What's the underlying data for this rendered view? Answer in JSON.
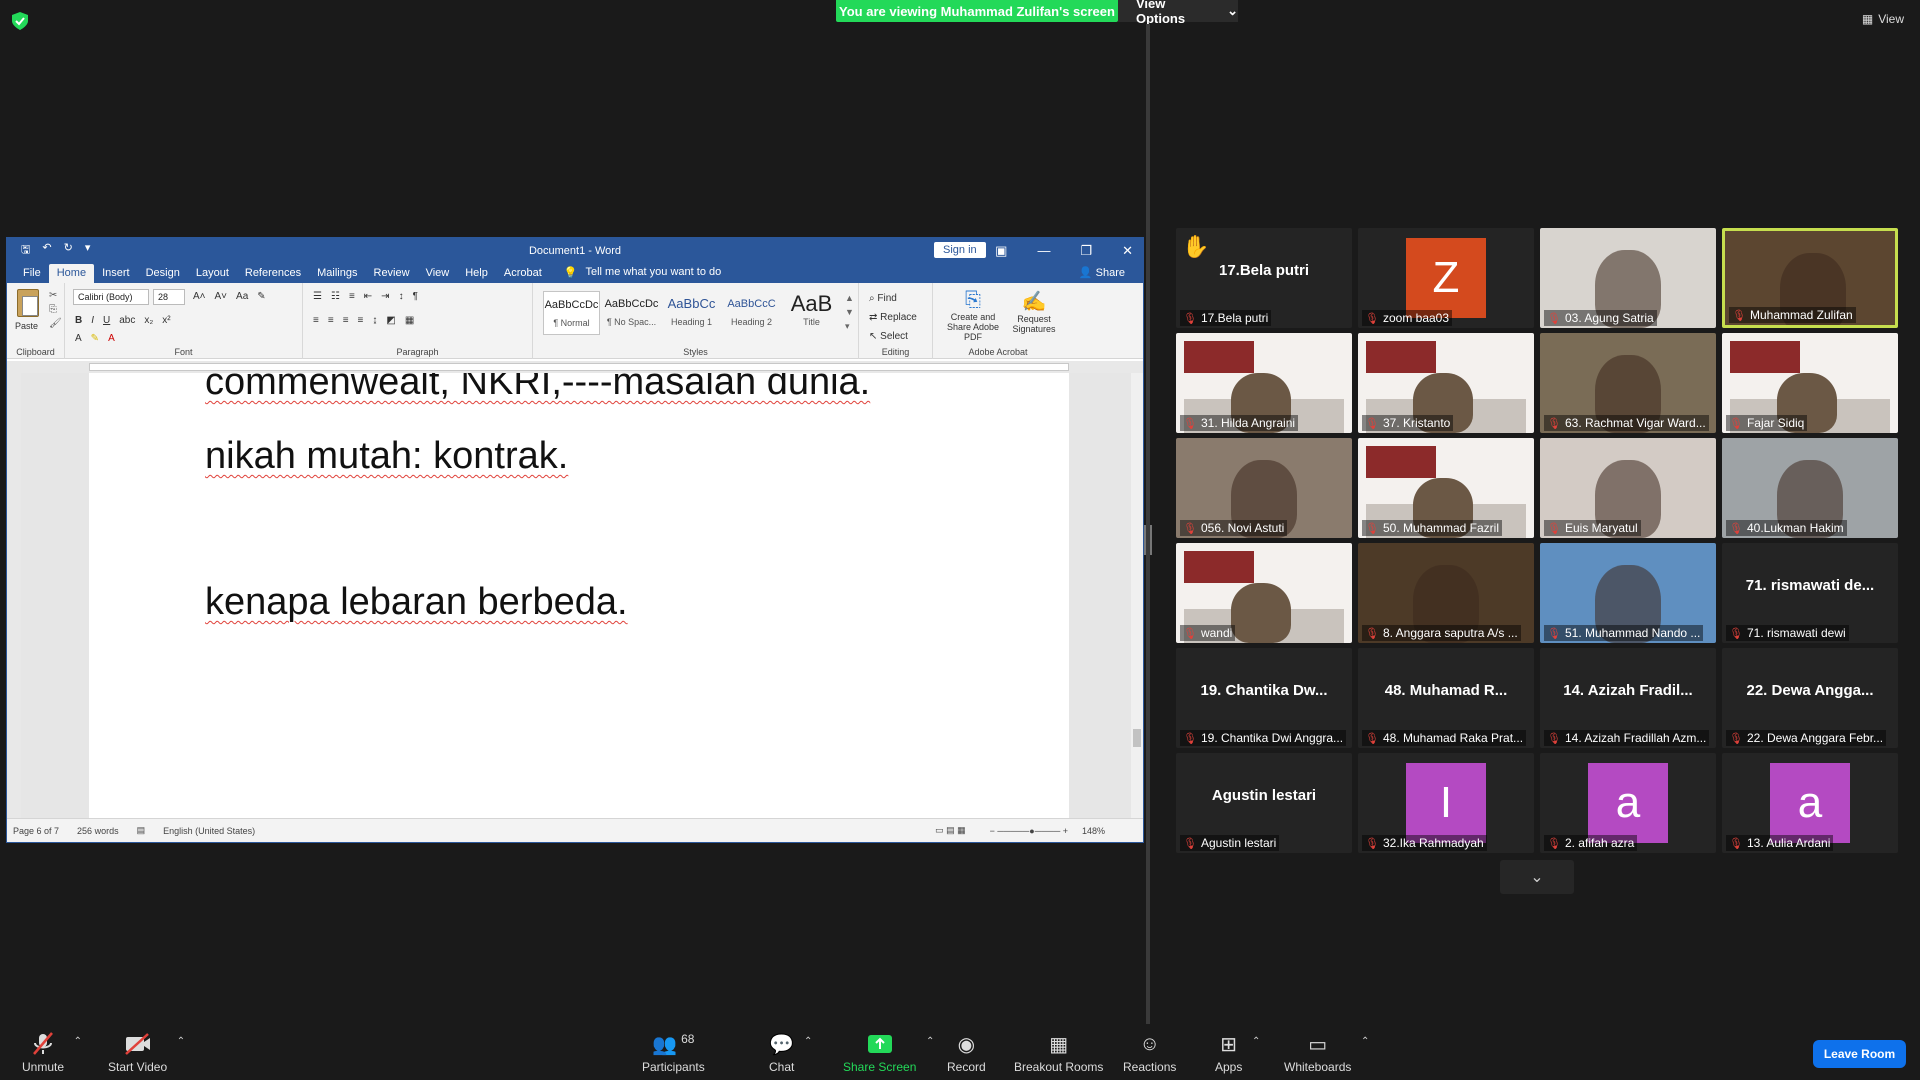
{
  "banner": {
    "text": "You are viewing Muhammad Zulifan's screen",
    "view_options": "View Options",
    "view": "View"
  },
  "word": {
    "title": "Document1 - Word",
    "sign_in": "Sign in",
    "tabs": [
      "File",
      "Home",
      "Insert",
      "Design",
      "Layout",
      "References",
      "Mailings",
      "Review",
      "View",
      "Help",
      "Acrobat"
    ],
    "tell_me": "Tell me what you want to do",
    "share": "Share",
    "font": {
      "name": "Calibri (Body)",
      "size": "28"
    },
    "groups": {
      "clipboard": "Clipboard",
      "font": "Font",
      "paragraph": "Paragraph",
      "styles": "Styles",
      "editing": "Editing",
      "acrobat": "Adobe Acrobat"
    },
    "paste": "Paste",
    "styles": [
      {
        "sample": "AaBbCcDc",
        "name": "¶ Normal"
      },
      {
        "sample": "AaBbCcDc",
        "name": "¶ No Spac..."
      },
      {
        "sample": "AaBbCc",
        "name": "Heading 1"
      },
      {
        "sample": "AaBbCcC",
        "name": "Heading 2"
      },
      {
        "sample": "AaB",
        "name": "Title"
      }
    ],
    "editing": {
      "find": "Find",
      "replace": "Replace",
      "select": "Select"
    },
    "acrobat": {
      "create": "Create and Share Adobe PDF",
      "request": "Request Signatures"
    },
    "doc_lines": [
      "commenwealt, NKRI,----masalah dunia.",
      "nikah mutah: kontrak.",
      "kenapa lebaran berbeda."
    ],
    "status": {
      "page": "Page 6 of 7",
      "words": "256 words",
      "language": "English (United States)",
      "zoom": "148%"
    }
  },
  "participants_grid": [
    {
      "label": "17.Bela putri",
      "big": "17.Bela putri",
      "type": "name",
      "hand": true
    },
    {
      "label": "zoom baa03",
      "type": "avatar",
      "letter": "Z",
      "color": "#d44a1e"
    },
    {
      "label": "03. Agung Satria",
      "type": "video",
      "bg": "#d8d4cf"
    },
    {
      "label": "Muhammad Zulifan",
      "type": "video",
      "bg": "#5c4630",
      "active": true
    },
    {
      "label": "31. Hilda Angraini",
      "type": "slide"
    },
    {
      "label": "37. Kristanto",
      "type": "slide"
    },
    {
      "label": "63. Rachmat Vigar Ward...",
      "type": "video",
      "bg": "#7a6c56"
    },
    {
      "label": "Fajar Sidiq",
      "type": "slide"
    },
    {
      "label": "056. Novi Astuti",
      "type": "video",
      "bg": "#8a7b6d"
    },
    {
      "label": "50. Muhammad Fazril",
      "type": "slide"
    },
    {
      "label": "Euis Maryatul",
      "type": "video",
      "bg": "#d3cbc5"
    },
    {
      "label": "40.Lukman Hakim",
      "type": "video",
      "bg": "#9ea3a6"
    },
    {
      "label": "wandi",
      "type": "slide"
    },
    {
      "label": "8. Anggara saputra A/s ...",
      "type": "video",
      "bg": "#4d3a27"
    },
    {
      "label": "51. Muhammad Nando ...",
      "type": "video",
      "bg": "#5f8fc0"
    },
    {
      "label": "71. rismawati dewi",
      "big": "71. rismawati de...",
      "type": "name"
    },
    {
      "label": "19. Chantika Dwi Anggra...",
      "big": "19. Chantika Dw...",
      "type": "name"
    },
    {
      "label": "48. Muhamad Raka Prat...",
      "big": "48. Muhamad R...",
      "type": "name"
    },
    {
      "label": "14. Azizah Fradillah Azm...",
      "big": "14. Azizah Fradil...",
      "type": "name"
    },
    {
      "label": "22. Dewa Anggara Febr...",
      "big": "22. Dewa Angga...",
      "type": "name"
    },
    {
      "label": "Agustin lestari",
      "big": "Agustin lestari",
      "type": "name"
    },
    {
      "label": "32.Ika Rahmadyah",
      "type": "avatar",
      "letter": "I",
      "color": "#b44ac2"
    },
    {
      "label": "2. afifah azra",
      "type": "avatar",
      "letter": "a",
      "color": "#b44ac2"
    },
    {
      "label": "13. Aulia Ardani",
      "type": "avatar",
      "letter": "a",
      "color": "#b44ac2"
    }
  ],
  "toolbar": {
    "unmute": "Unmute",
    "start_video": "Start Video",
    "participants": "Participants",
    "participants_count": "68",
    "chat": "Chat",
    "share_screen": "Share Screen",
    "record": "Record",
    "breakout": "Breakout Rooms",
    "reactions": "Reactions",
    "apps": "Apps",
    "whiteboards": "Whiteboards",
    "leave": "Leave Room"
  },
  "colors": {
    "share_green": "#23d959",
    "leave_blue": "#0e71eb",
    "word_blue": "#2b579a",
    "active_border": "#c6de4e"
  }
}
